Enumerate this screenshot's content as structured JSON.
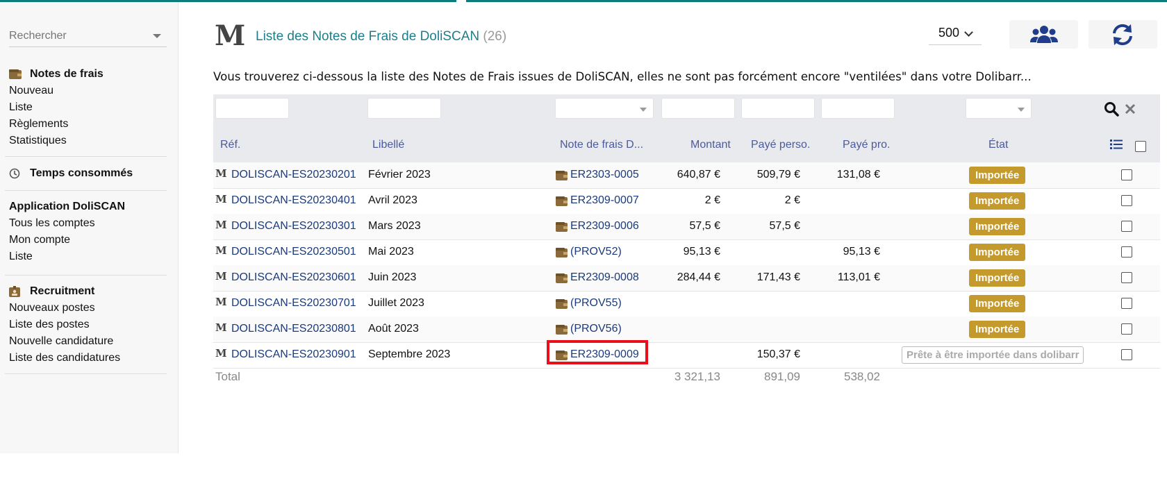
{
  "sidebar": {
    "search_placeholder": "Rechercher",
    "sections": [
      {
        "label": "Notes de frais",
        "icon": "wallet-icon",
        "items": [
          "Nouveau",
          "Liste",
          "Règlements",
          "Statistiques"
        ]
      },
      {
        "label": "Temps consommés",
        "icon": "clock-icon",
        "items": []
      },
      {
        "label": "Application DoliSCAN",
        "icon": "",
        "items": [
          "Tous les comptes",
          "Mon compte",
          "Liste"
        ]
      },
      {
        "label": "Recruitment",
        "icon": "id-badge-icon",
        "items": [
          "Nouveaux postes",
          "Liste des postes",
          "Nouvelle candidature",
          "Liste des candidatures"
        ]
      }
    ]
  },
  "header": {
    "logo": "M",
    "title": "Liste des Notes de Frais de DoliSCAN",
    "count": "(26)",
    "per_page": "500",
    "intro": "Vous trouverez ci-dessous la liste des Notes de Frais issues de DoliSCAN, elles ne sont pas forcément encore \"ventilées\" dans votre Dolibarr..."
  },
  "table": {
    "columns": [
      "Réf.",
      "Libellé",
      "Note de frais D...",
      "Montant",
      "Payé perso.",
      "Payé pro.",
      "État"
    ],
    "rows": [
      {
        "ref": "DOLISCAN-ES20230201",
        "label": "Février 2023",
        "note": "ER2303-0005",
        "amount": "640,87 €",
        "perso": "509,79 €",
        "pro": "131,08 €",
        "state": "Importée"
      },
      {
        "ref": "DOLISCAN-ES20230401",
        "label": "Avril 2023",
        "note": "ER2309-0007",
        "amount": "2 €",
        "perso": "2 €",
        "pro": "",
        "state": "Importée"
      },
      {
        "ref": "DOLISCAN-ES20230301",
        "label": "Mars 2023",
        "note": "ER2309-0006",
        "amount": "57,5 €",
        "perso": "57,5 €",
        "pro": "",
        "state": "Importée"
      },
      {
        "ref": "DOLISCAN-ES20230501",
        "label": "Mai 2023",
        "note": "(PROV52)",
        "amount": "95,13 €",
        "perso": "",
        "pro": "95,13 €",
        "state": "Importée"
      },
      {
        "ref": "DOLISCAN-ES20230601",
        "label": "Juin 2023",
        "note": "ER2309-0008",
        "amount": "284,44 €",
        "perso": "171,43 €",
        "pro": "113,01 €",
        "state": "Importée"
      },
      {
        "ref": "DOLISCAN-ES20230701",
        "label": "Juillet 2023",
        "note": "(PROV55)",
        "amount": "",
        "perso": "",
        "pro": "",
        "state": "Importée"
      },
      {
        "ref": "DOLISCAN-ES20230801",
        "label": "Août 2023",
        "note": "(PROV56)",
        "amount": "",
        "perso": "",
        "pro": "",
        "state": "Importée"
      },
      {
        "ref": "DOLISCAN-ES20230901",
        "label": "Septembre 2023",
        "note": "ER2309-0009",
        "amount": "",
        "perso": "150,37 €",
        "pro": "",
        "state": "Prête à être importée dans dolibarr"
      }
    ],
    "total": {
      "label": "Total",
      "amount": "3 321,13",
      "perso": "891,09",
      "pro": "538,02"
    }
  },
  "colors": {
    "accent": "#0d7d7b",
    "badge": "#c49a2c",
    "link": "#1a3a7a",
    "highlight": "#e8101b"
  }
}
